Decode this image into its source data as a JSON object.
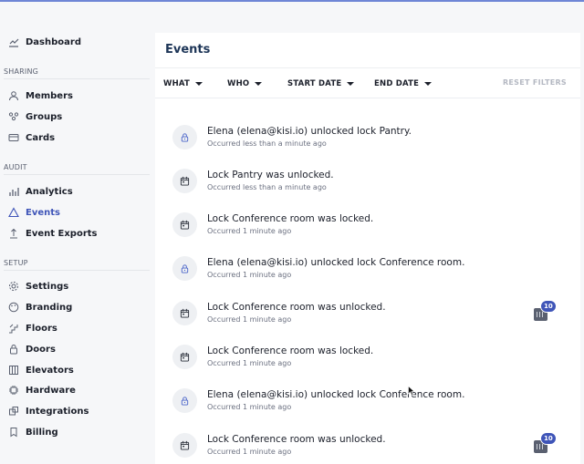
{
  "sidebar": {
    "top_item": {
      "label": "Dashboard",
      "icon": "chart-line-icon"
    },
    "sections": [
      {
        "label": "SHARING",
        "items": [
          {
            "label": "Members",
            "icon": "person-icon"
          },
          {
            "label": "Groups",
            "icon": "group-icon"
          },
          {
            "label": "Cards",
            "icon": "card-icon"
          }
        ]
      },
      {
        "label": "AUDIT",
        "items": [
          {
            "label": "Analytics",
            "icon": "bar-chart-icon"
          },
          {
            "label": "Events",
            "icon": "warning-triangle-icon",
            "active": true
          },
          {
            "label": "Event Exports",
            "icon": "upload-icon"
          }
        ]
      },
      {
        "label": "SETUP",
        "items": [
          {
            "label": "Settings",
            "icon": "gear-icon"
          },
          {
            "label": "Branding",
            "icon": "palette-icon"
          },
          {
            "label": "Floors",
            "icon": "stairs-icon"
          },
          {
            "label": "Doors",
            "icon": "door-lock-icon"
          },
          {
            "label": "Elevators",
            "icon": "elevator-icon"
          },
          {
            "label": "Hardware",
            "icon": "chip-icon"
          },
          {
            "label": "Integrations",
            "icon": "puzzle-icon"
          },
          {
            "label": "Billing",
            "icon": "bookmark-icon"
          }
        ]
      }
    ]
  },
  "main": {
    "title": "Events",
    "filters": [
      {
        "label": "WHAT"
      },
      {
        "label": "WHO"
      },
      {
        "label": "START DATE"
      },
      {
        "label": "END DATE"
      }
    ],
    "reset_label": "RESET FILTERS"
  },
  "events": [
    {
      "title": "Elena (elena@kisi.io) unlocked lock Pantry.",
      "time": "Occurred less than a minute ago",
      "icon": "lock-icon"
    },
    {
      "title": "Lock Pantry was unlocked.",
      "time": "Occurred less than a minute ago",
      "icon": "calendar-icon"
    },
    {
      "title": "Lock Conference room was locked.",
      "time": "Occurred 1 minute ago",
      "icon": "calendar-icon"
    },
    {
      "title": "Elena (elena@kisi.io) unlocked lock Conference room.",
      "time": "Occurred 1 minute ago",
      "icon": "lock-icon"
    },
    {
      "title": "Lock Conference room was unlocked.",
      "time": "Occurred 1 minute ago",
      "icon": "calendar-icon",
      "badge": "10"
    },
    {
      "title": "Lock Conference room was locked.",
      "time": "Occurred 1 minute ago",
      "icon": "calendar-icon"
    },
    {
      "title": "Elena (elena@kisi.io) unlocked lock Conference room.",
      "time": "Occurred 1 minute ago",
      "icon": "lock-icon"
    },
    {
      "title": "Lock Conference room was unlocked.",
      "time": "Occurred 1 minute ago",
      "icon": "calendar-icon",
      "badge": "10"
    }
  ],
  "colors": {
    "accent": "#3f55b8",
    "title": "#1d3557",
    "muted": "#6b7080"
  }
}
